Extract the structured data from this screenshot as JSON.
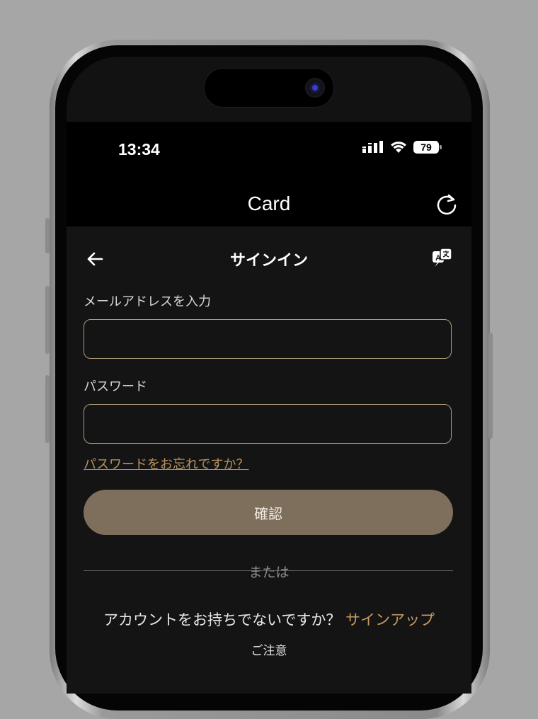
{
  "status_bar": {
    "time": "13:34",
    "battery": "79"
  },
  "app_bar": {
    "title": "Card"
  },
  "page": {
    "title": "サインイン"
  },
  "form": {
    "email_label": "メールアドレスを入力",
    "email_value": "",
    "password_label": "パスワード",
    "password_value": "",
    "forgot_link": "パスワードをお忘れですか？",
    "confirm_label": "確認"
  },
  "or_text": "または",
  "signup": {
    "prompt": "アカウントをお持ちでないですか？",
    "link": "サインアップ"
  },
  "notice": {
    "title": "ご注意",
    "body": ""
  },
  "icons": {
    "back": "arrow-left-icon",
    "refresh": "refresh-icon",
    "translate": "translate-icon",
    "signal": "signal-icon",
    "wifi": "wifi-icon",
    "battery": "battery-icon"
  },
  "colors": {
    "accent": "#c79a5f",
    "field_border": "#b09b78",
    "button_bg": "#7e6f5d",
    "background": "#141414"
  }
}
